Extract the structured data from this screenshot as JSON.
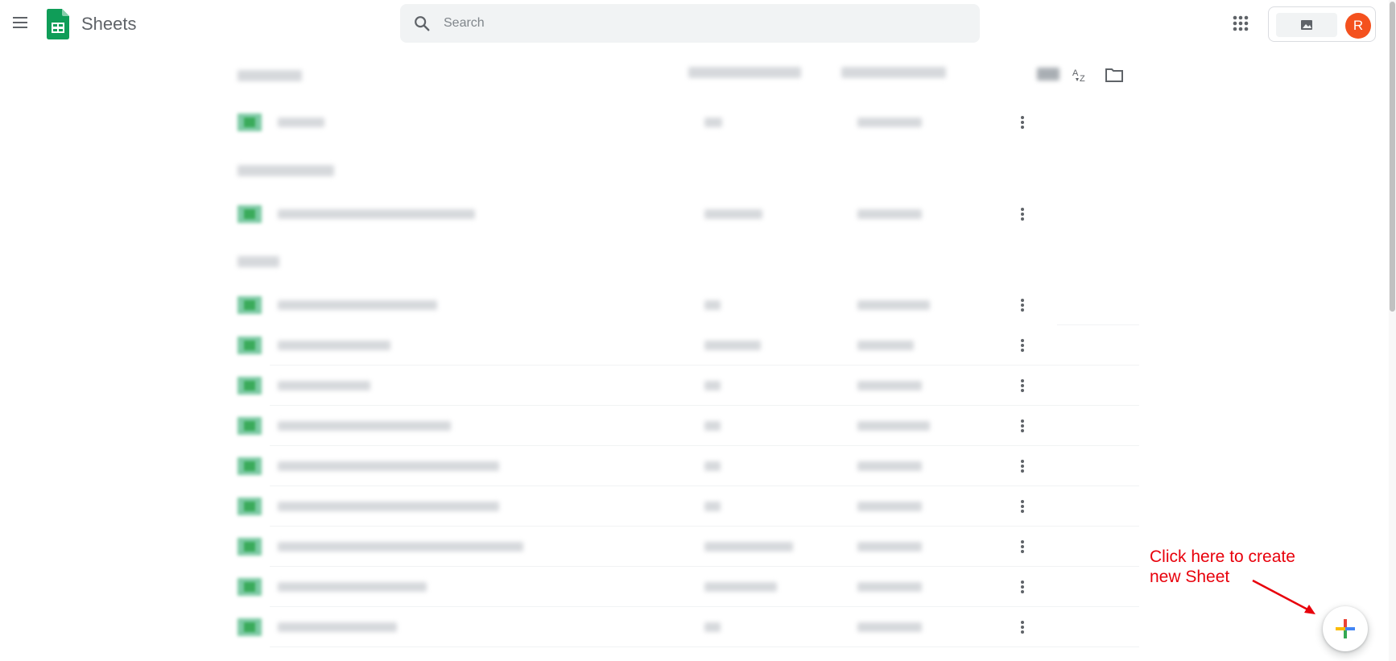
{
  "app": {
    "title": "Sheets"
  },
  "search": {
    "placeholder": "Search"
  },
  "account": {
    "avatar_letter": "R"
  },
  "colors": {
    "accent_green": "#0f9d58",
    "avatar_bg": "#f4511e",
    "annotation_red": "#e8000b"
  },
  "icons": {
    "menu": "hamburger-menu-icon",
    "logo": "google-sheets-logo",
    "search": "search-icon",
    "apps": "apps-grid-icon",
    "sort": "sort-az-icon",
    "folder": "folder-icon",
    "more": "more-vert-icon",
    "create": "plus-icon"
  },
  "annotation": {
    "callout_line1": "Click here to create",
    "callout_line2": "new Sheet"
  }
}
